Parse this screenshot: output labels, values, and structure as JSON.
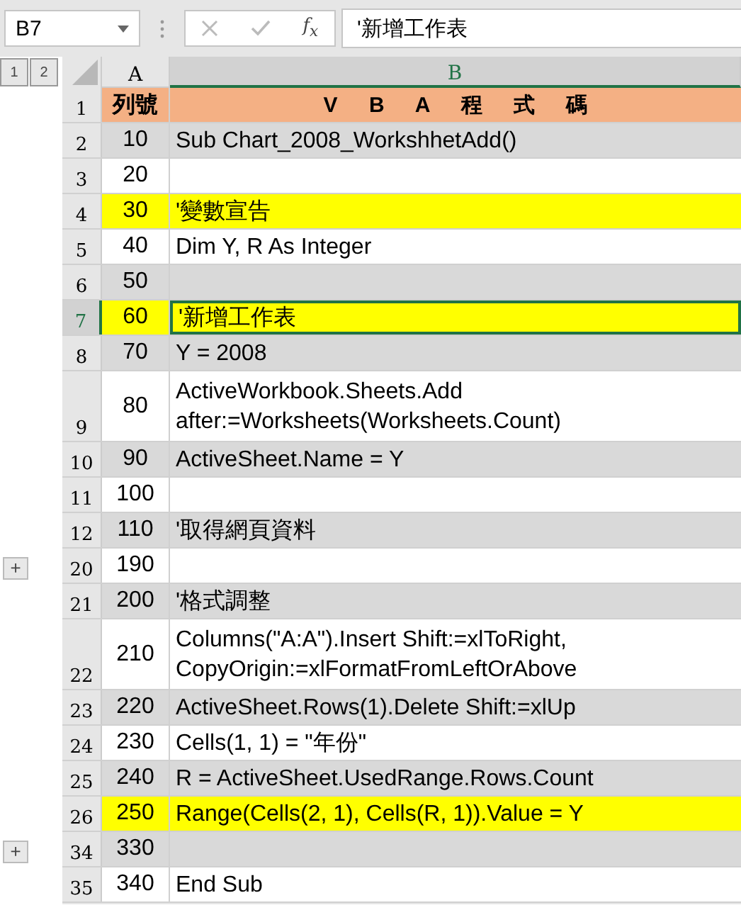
{
  "formula_bar": {
    "name_box": "B7",
    "function_button": "f$_{x}$",
    "formula": "'新增工作表",
    "cancel_disabled": true,
    "enter_disabled": true
  },
  "outline_levels": [
    "1",
    "2"
  ],
  "columns": [
    {
      "label": "A",
      "selected": false
    },
    {
      "label": "B",
      "selected": true
    }
  ],
  "rows": [
    {
      "header": "1",
      "a": "列號",
      "b": "V B A 程 式 碼",
      "kind": "header",
      "selected": false
    },
    {
      "header": "2",
      "a": "10",
      "b": "Sub Chart_2008_WorkshhetAdd()",
      "kind": "gray",
      "selected": false
    },
    {
      "header": "3",
      "a": "20",
      "b": "",
      "kind": "white",
      "selected": false
    },
    {
      "header": "4",
      "a": "30",
      "b": "'變數宣告",
      "kind": "yellow",
      "selected": false
    },
    {
      "header": "5",
      "a": "40",
      "b": "Dim Y, R As Integer",
      "kind": "white",
      "selected": false
    },
    {
      "header": "6",
      "a": "50",
      "b": "",
      "kind": "gray",
      "selected": false
    },
    {
      "header": "7",
      "a": "60",
      "b": "'新增工作表",
      "kind": "yellow",
      "selected": true
    },
    {
      "header": "8",
      "a": "70",
      "b": "Y = 2008",
      "kind": "gray",
      "selected": false
    },
    {
      "header": "9",
      "a": "80",
      "b": "ActiveWorkbook.Sheets.Add after:=Worksheets(Worksheets.Count)",
      "kind": "white",
      "selected": false
    },
    {
      "header": "10",
      "a": "90",
      "b": "ActiveSheet.Name = Y",
      "kind": "gray",
      "selected": false
    },
    {
      "header": "11",
      "a": "100",
      "b": "",
      "kind": "white",
      "selected": false
    },
    {
      "header": "12",
      "a": "110",
      "b": "'取得網頁資料",
      "kind": "gray",
      "selected": false
    },
    {
      "header": "20",
      "a": "190",
      "b": "",
      "kind": "white",
      "selected": false,
      "outline_button": "+"
    },
    {
      "header": "21",
      "a": "200",
      "b": "'格式調整",
      "kind": "gray",
      "selected": false
    },
    {
      "header": "22",
      "a": "210",
      "b": "Columns(\"A:A\").Insert Shift:=xlToRight, CopyOrigin:=xlFormatFromLeftOrAbove",
      "kind": "white",
      "selected": false
    },
    {
      "header": "23",
      "a": "220",
      "b": "ActiveSheet.Rows(1).Delete Shift:=xlUp",
      "kind": "gray",
      "selected": false
    },
    {
      "header": "24",
      "a": "230",
      "b": "Cells(1, 1) = \"年份\"",
      "kind": "white",
      "selected": false
    },
    {
      "header": "25",
      "a": "240",
      "b": "R = ActiveSheet.UsedRange.Rows.Count",
      "kind": "gray",
      "selected": false
    },
    {
      "header": "26",
      "a": "250",
      "b": "Range(Cells(2, 1), Cells(R, 1)).Value = Y",
      "kind": "yellow",
      "selected": false
    },
    {
      "header": "34",
      "a": "330",
      "b": "",
      "kind": "gray",
      "selected": false,
      "outline_button": "+"
    },
    {
      "header": "35",
      "a": "340",
      "b": "End Sub",
      "kind": "white",
      "selected": false
    }
  ]
}
